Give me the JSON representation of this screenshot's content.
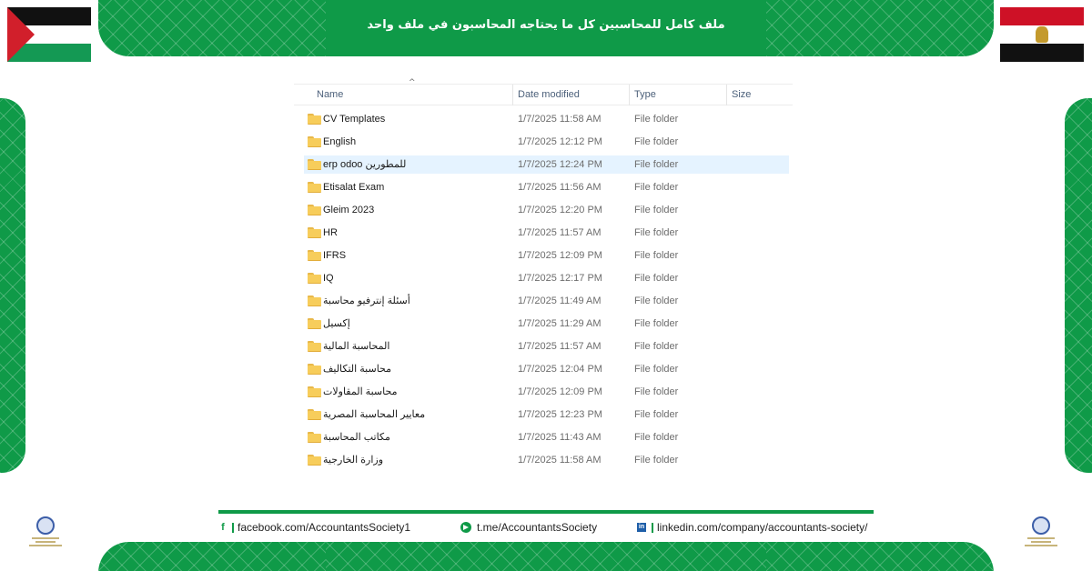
{
  "banner": {
    "title": "ملف كامل للمحاسبين كل ما يحتاجه المحاسبون في ملف واحد"
  },
  "colors": {
    "brand_green": "#0f9a48",
    "selection": "#e5f3ff",
    "folder": "#f7cd5b"
  },
  "explorer": {
    "columns": {
      "name": "Name",
      "date_modified": "Date modified",
      "type": "Type",
      "size": "Size"
    },
    "sort_indicator": "^",
    "rows": [
      {
        "name": "CV Templates",
        "date": "1/7/2025 11:58 AM",
        "type": "File folder",
        "selected": false
      },
      {
        "name": "English",
        "date": "1/7/2025 12:12 PM",
        "type": "File folder",
        "selected": false
      },
      {
        "name": "erp odoo للمطورين",
        "date": "1/7/2025 12:24 PM",
        "type": "File folder",
        "selected": true
      },
      {
        "name": "Etisalat Exam",
        "date": "1/7/2025 11:56 AM",
        "type": "File folder",
        "selected": false
      },
      {
        "name": "Gleim 2023",
        "date": "1/7/2025 12:20 PM",
        "type": "File folder",
        "selected": false
      },
      {
        "name": "HR",
        "date": "1/7/2025 11:57 AM",
        "type": "File folder",
        "selected": false
      },
      {
        "name": "IFRS",
        "date": "1/7/2025 12:09 PM",
        "type": "File folder",
        "selected": false
      },
      {
        "name": "IQ",
        "date": "1/7/2025 12:17 PM",
        "type": "File folder",
        "selected": false
      },
      {
        "name": "أسئلة إنترفيو محاسبة",
        "date": "1/7/2025 11:49 AM",
        "type": "File folder",
        "selected": false
      },
      {
        "name": "إكسيل",
        "date": "1/7/2025 11:29 AM",
        "type": "File folder",
        "selected": false
      },
      {
        "name": "المحاسبة المالية",
        "date": "1/7/2025 11:57 AM",
        "type": "File folder",
        "selected": false
      },
      {
        "name": "محاسبة التكاليف",
        "date": "1/7/2025 12:04 PM",
        "type": "File folder",
        "selected": false
      },
      {
        "name": "محاسبة المقاولات",
        "date": "1/7/2025 12:09 PM",
        "type": "File folder",
        "selected": false
      },
      {
        "name": "معايير المحاسبة المصرية",
        "date": "1/7/2025 12:23 PM",
        "type": "File folder",
        "selected": false
      },
      {
        "name": "مكاتب المحاسبة",
        "date": "1/7/2025 11:43 AM",
        "type": "File folder",
        "selected": false
      },
      {
        "name": "وزارة الخارجية",
        "date": "1/7/2025 11:58 AM",
        "type": "File folder",
        "selected": false
      }
    ]
  },
  "social": {
    "facebook_icon": "f",
    "facebook": "facebook.com/AccountantsSociety1",
    "telegram": "t.me/AccountantsSociety",
    "linkedin_icon": "in",
    "linkedin": "linkedin.com/company/accountants-society/"
  },
  "icons": {
    "folder": "folder-icon",
    "telegram": "telegram-icon",
    "linkedin": "linkedin-icon",
    "facebook": "facebook-icon"
  }
}
